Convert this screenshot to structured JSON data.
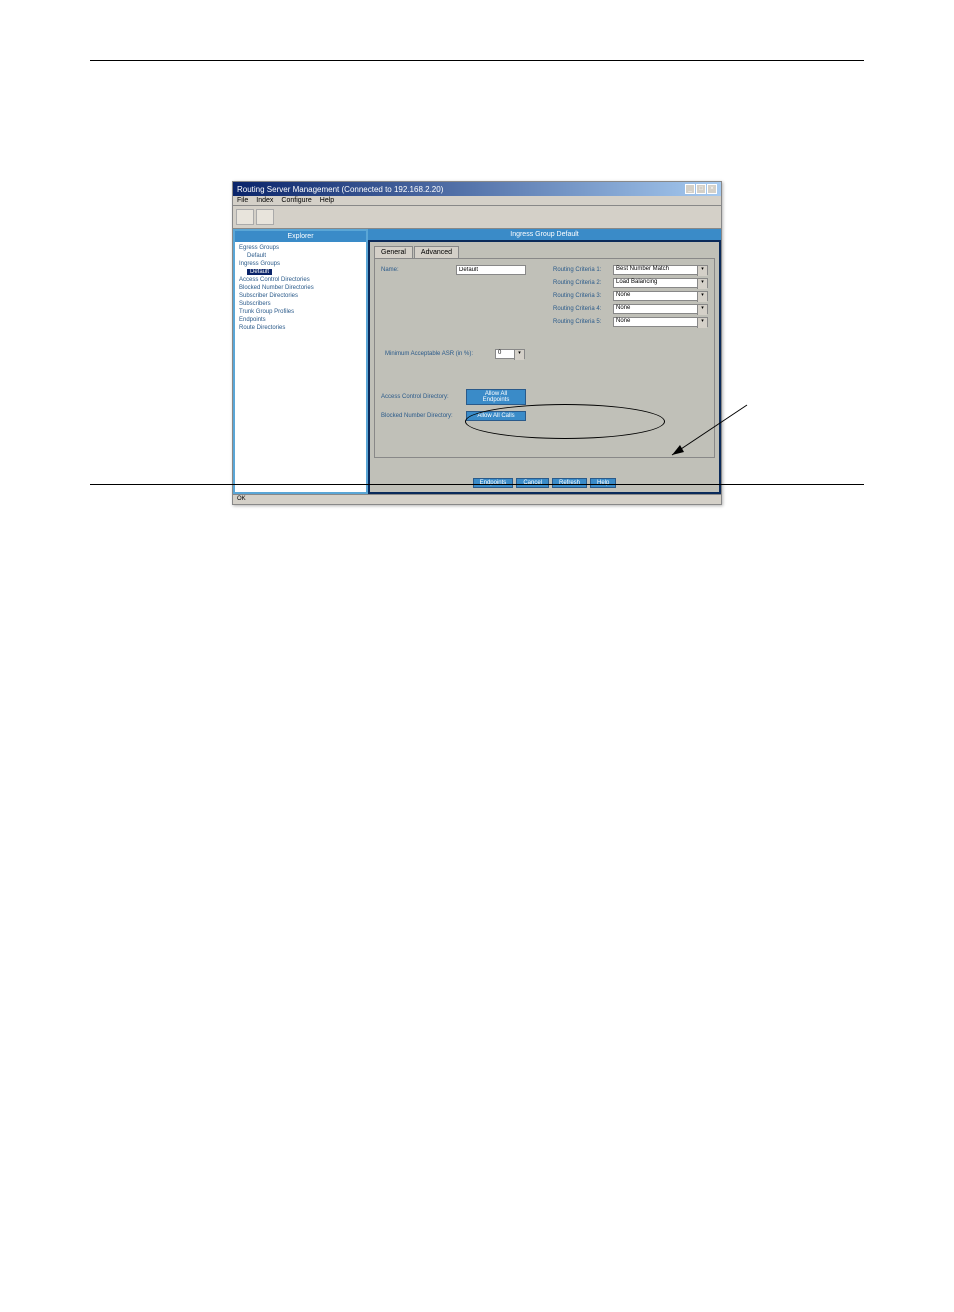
{
  "window": {
    "title": "Routing Server Management (Connected to 192.168.2.20)",
    "menu": [
      "File",
      "Index",
      "Configure",
      "Help"
    ],
    "status": "OK"
  },
  "leftPanel": {
    "header": "Explorer",
    "tree": {
      "egressGroups": "Egress Groups",
      "egressDefault": "Default",
      "ingressGroups": "Ingress Groups",
      "ingressSelected": "Default",
      "items": [
        "Access Control Directories",
        "Blocked Number Directories",
        "Subscriber Directories",
        "Subscribers",
        "Trunk Group Profiles",
        "Endpoints",
        "Route Directories"
      ]
    }
  },
  "rightPanel": {
    "header": "Ingress Group Default",
    "tabs": {
      "general": "General",
      "advanced": "Advanced"
    },
    "form": {
      "nameLabel": "Name:",
      "nameValue": "Default",
      "minAcceptLabel": "Minimum Acceptable ASR (in %):",
      "minAcceptValue": "0"
    },
    "criteria": [
      {
        "label": "Routing Criteria 1:",
        "value": "Best Number Match"
      },
      {
        "label": "Routing Criteria 2:",
        "value": "Load Balancing"
      },
      {
        "label": "Routing Criteria 3:",
        "value": "None"
      },
      {
        "label": "Routing Criteria 4:",
        "value": "None"
      },
      {
        "label": "Routing Criteria 5:",
        "value": "None"
      }
    ],
    "directories": {
      "accessLabel": "Access Control Directory:",
      "accessBtn": "Allow All Endpoints",
      "blockedLabel": "Blocked Number Directory:",
      "blockedBtn": "Allow All Calls"
    },
    "buttons": {
      "endpoints": "Endpoints",
      "cancel": "Cancel",
      "refresh": "Refresh",
      "help": "Help"
    }
  }
}
